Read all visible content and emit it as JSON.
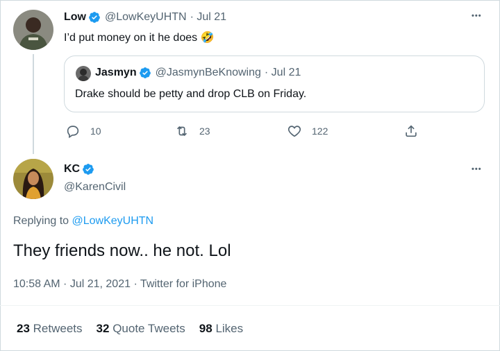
{
  "tweet": {
    "author_name": "Low",
    "author_handle": "@LowKeyUHTN",
    "date": "· Jul 21",
    "text": "I’d put money on it he does",
    "emoji": "🤣",
    "more_label": "•••",
    "quote": {
      "author_name": "Jasmyn",
      "author_handle": "@JasmynBeKnowing",
      "date": "· Jul 21",
      "text": "Drake should be petty and drop CLB on Friday."
    },
    "actions": {
      "replies": "10",
      "retweets": "23",
      "likes": "122"
    }
  },
  "reply": {
    "author_name": "KC",
    "author_handle": "@KarenCivil",
    "more_label": "•••",
    "replying_prefix": "Replying to",
    "replying_to": "@LowKeyUHTN",
    "text": "They friends now.. he not. Lol",
    "timestamp": "10:58 AM · Jul 21, 2021 · Twitter for iPhone",
    "stats": {
      "retweets_count": "23",
      "retweets_label": "Retweets",
      "quotes_count": "32",
      "quotes_label": "Quote Tweets",
      "likes_count": "98",
      "likes_label": "Likes"
    }
  },
  "colors": {
    "accent": "#1d9bf0",
    "muted": "#536471",
    "border": "#cfd9de"
  }
}
